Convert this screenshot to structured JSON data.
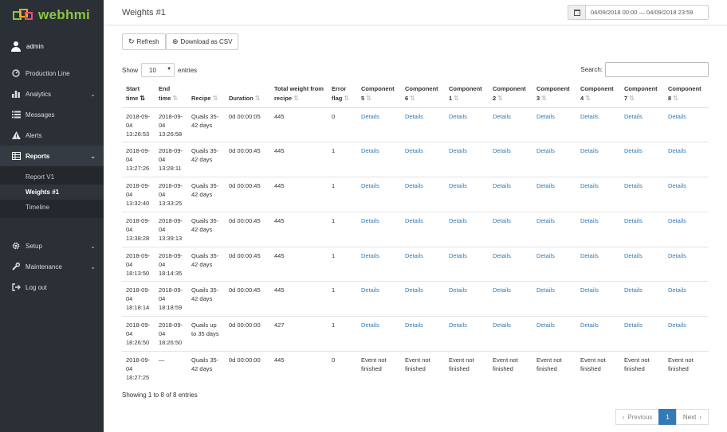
{
  "brand": {
    "name": "webhmi"
  },
  "user": {
    "name": "admin"
  },
  "nav": {
    "production_line": "Production Line",
    "analytics": "Analytics",
    "messages": "Messages",
    "alerts": "Alerts",
    "reports": "Reports",
    "reports_sub": [
      "Report V1",
      "Weights #1",
      "Timeline"
    ],
    "setup": "Setup",
    "maintenance": "Maintenance",
    "logout": "Log out"
  },
  "page": {
    "title": "Weights #1"
  },
  "daterange": {
    "value": "04/09/2018 00:00 — 04/09/2018 23:59"
  },
  "toolbar": {
    "refresh": "Refresh",
    "download": "Download as CSV"
  },
  "table_controls": {
    "show_label": "Show",
    "entries_value": "10",
    "entries_label": "entries",
    "search_label": "Search:",
    "search_value": ""
  },
  "table": {
    "columns": [
      "Start time",
      "End time",
      "Recipe",
      "Duration",
      "Total weight from recipe",
      "Error flag",
      "Component 5",
      "Component 6",
      "Component 1",
      "Component 2",
      "Component 3",
      "Component 4",
      "Component 7",
      "Component 8"
    ],
    "rows": [
      [
        "2018-09-04 13:26:53",
        "2018-09-04 13:26:58",
        "Quails 35-42 days",
        "0d 00:00:05",
        "445",
        "0",
        "Details",
        "Details",
        "Details",
        "Details",
        "Details",
        "Details",
        "Details",
        "Details"
      ],
      [
        "2018-09-04 13:27:26",
        "2018-09-04 13:28:11",
        "Quails 35-42 days",
        "0d 00:00:45",
        "445",
        "1",
        "Details",
        "Details",
        "Details",
        "Details",
        "Details",
        "Details",
        "Details",
        "Details"
      ],
      [
        "2018-09-04 13:32:40",
        "2018-09-04 13:33:25",
        "Quails 35-42 days",
        "0d 00:00:45",
        "445",
        "1",
        "Details",
        "Details",
        "Details",
        "Details",
        "Details",
        "Details",
        "Details",
        "Details"
      ],
      [
        "2018-09-04 13:38:28",
        "2018-09-04 13:39:13",
        "Quails 35-42 days",
        "0d 00:00:45",
        "445",
        "1",
        "Details",
        "Details",
        "Details",
        "Details",
        "Details",
        "Details",
        "Details",
        "Details"
      ],
      [
        "2018-09-04 18:13:50",
        "2018-09-04 18:14:35",
        "Quails 35-42 days",
        "0d 00:00:45",
        "445",
        "1",
        "Details",
        "Details",
        "Details",
        "Details",
        "Details",
        "Details",
        "Details",
        "Details"
      ],
      [
        "2018-09-04 18:18:14",
        "2018-09-04 18:18:59",
        "Quails 35-42 days",
        "0d 00:00:45",
        "445",
        "1",
        "Details",
        "Details",
        "Details",
        "Details",
        "Details",
        "Details",
        "Details",
        "Details"
      ],
      [
        "2018-09-04 18:26:50",
        "2018-09-04 18:26:50",
        "Quails up to 35 days",
        "0d 00:00:00",
        "427",
        "1",
        "Details",
        "Details",
        "Details",
        "Details",
        "Details",
        "Details",
        "Details",
        "Details"
      ],
      [
        "2018-09-04 18:27:25",
        "—",
        "Quails 35-42 days",
        "0d 00:00:00",
        "445",
        "0",
        "Event not finished",
        "Event not finished",
        "Event not finished",
        "Event not finished",
        "Event not finished",
        "Event not finished",
        "Event not finished",
        "Event not finished"
      ]
    ]
  },
  "footer": {
    "info": "Showing 1 to 8 of 8 entries",
    "previous": "Previous",
    "page": "1",
    "next": "Next"
  },
  "colors": {
    "sidebar_bg": "#2b3036",
    "link": "#337ab7",
    "brand_green": "#8cc63f"
  }
}
